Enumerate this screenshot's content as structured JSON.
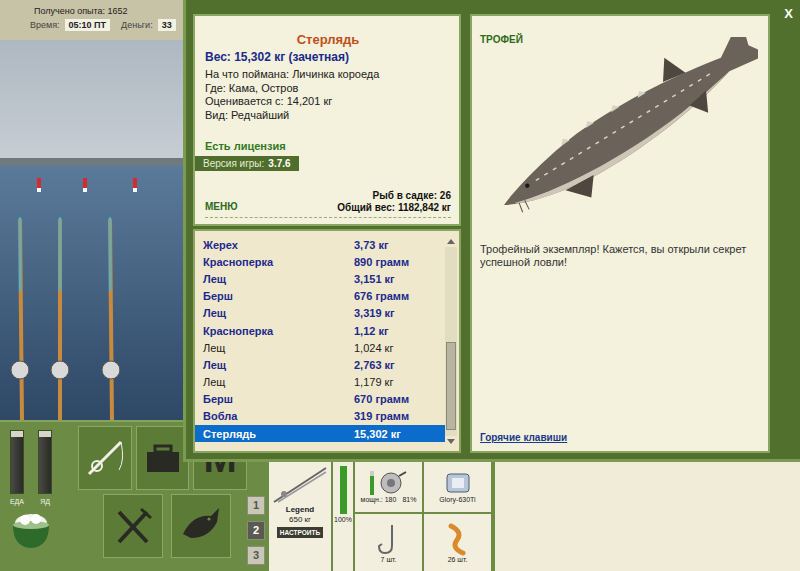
{
  "hud": {
    "experience": "Получено опыта: 1652",
    "time_label": "Время:",
    "time": "05:10 ПТ",
    "money_label": "Деньги:",
    "money": "33"
  },
  "gauges": [
    {
      "label": "ЕДА",
      "level": 0.9
    },
    {
      "label": "ЯД",
      "level": 0.9
    }
  ],
  "toolbar": {
    "map_label": "M"
  },
  "rod_sets": [
    {
      "label": "1",
      "selected": false
    },
    {
      "label": "2",
      "selected": true
    },
    {
      "label": "3",
      "selected": false
    }
  ],
  "tackle": {
    "rod": {
      "name": "Legend",
      "load": "650 кг",
      "condition": "100%",
      "level": 1.0,
      "setup_button": "НАСТРОИТЬ"
    },
    "reel": {
      "power": "мощн.: 180",
      "wear": "81%",
      "level": 0.81
    },
    "line": {
      "name": "Glory-630Ti"
    },
    "hook": {
      "count": "7 шт."
    },
    "bait": {
      "count": "26 шт."
    }
  },
  "dialog": {
    "close": "X",
    "fish": {
      "name": "Стерлядь",
      "weight": "Вес: 15,302 кг (зачетная)",
      "details": [
        "На что поймана: Личинка короеда",
        "Где: Кама, Остров",
        "Оценивается с: 14,201 кг",
        "Вид: Редчайший"
      ]
    },
    "license": "Есть лицензия",
    "version_label": "Версия игры:",
    "version": "3.7.6",
    "menu": "МЕНЮ",
    "keepnet_count": "Рыб в садке: 26",
    "keepnet_weight": "Общий вес: 1182,842 кг",
    "catches": [
      {
        "name": "Жерех",
        "weight": "3,73 кг",
        "counted": true,
        "selected": false
      },
      {
        "name": "Красноперка",
        "weight": "890 грамм",
        "counted": true,
        "selected": false
      },
      {
        "name": "Лещ",
        "weight": "3,151 кг",
        "counted": true,
        "selected": false
      },
      {
        "name": "Берш",
        "weight": "676 грамм",
        "counted": true,
        "selected": false
      },
      {
        "name": "Лещ",
        "weight": "3,319 кг",
        "counted": true,
        "selected": false
      },
      {
        "name": "Красноперка",
        "weight": "1,12 кг",
        "counted": true,
        "selected": false
      },
      {
        "name": "Лещ",
        "weight": "1,024 кг",
        "counted": false,
        "selected": false
      },
      {
        "name": "Лещ",
        "weight": "2,763 кг",
        "counted": true,
        "selected": false
      },
      {
        "name": "Лещ",
        "weight": "1,179 кг",
        "counted": false,
        "selected": false
      },
      {
        "name": "Берш",
        "weight": "670 грамм",
        "counted": true,
        "selected": false
      },
      {
        "name": "Вобла",
        "weight": "319 грамм",
        "counted": true,
        "selected": false
      },
      {
        "name": "Стерлядь",
        "weight": "15,302 кг",
        "counted": true,
        "selected": true
      }
    ],
    "scrollbar": {
      "offset": 0.5,
      "size": 0.47
    },
    "trophy": {
      "badge": "ТРОФЕЙ",
      "text": "Трофейный экземпляр! Кажется, вы открыли секрет успешной ловли!",
      "hotkeys": "Горячие клавиши"
    }
  }
}
